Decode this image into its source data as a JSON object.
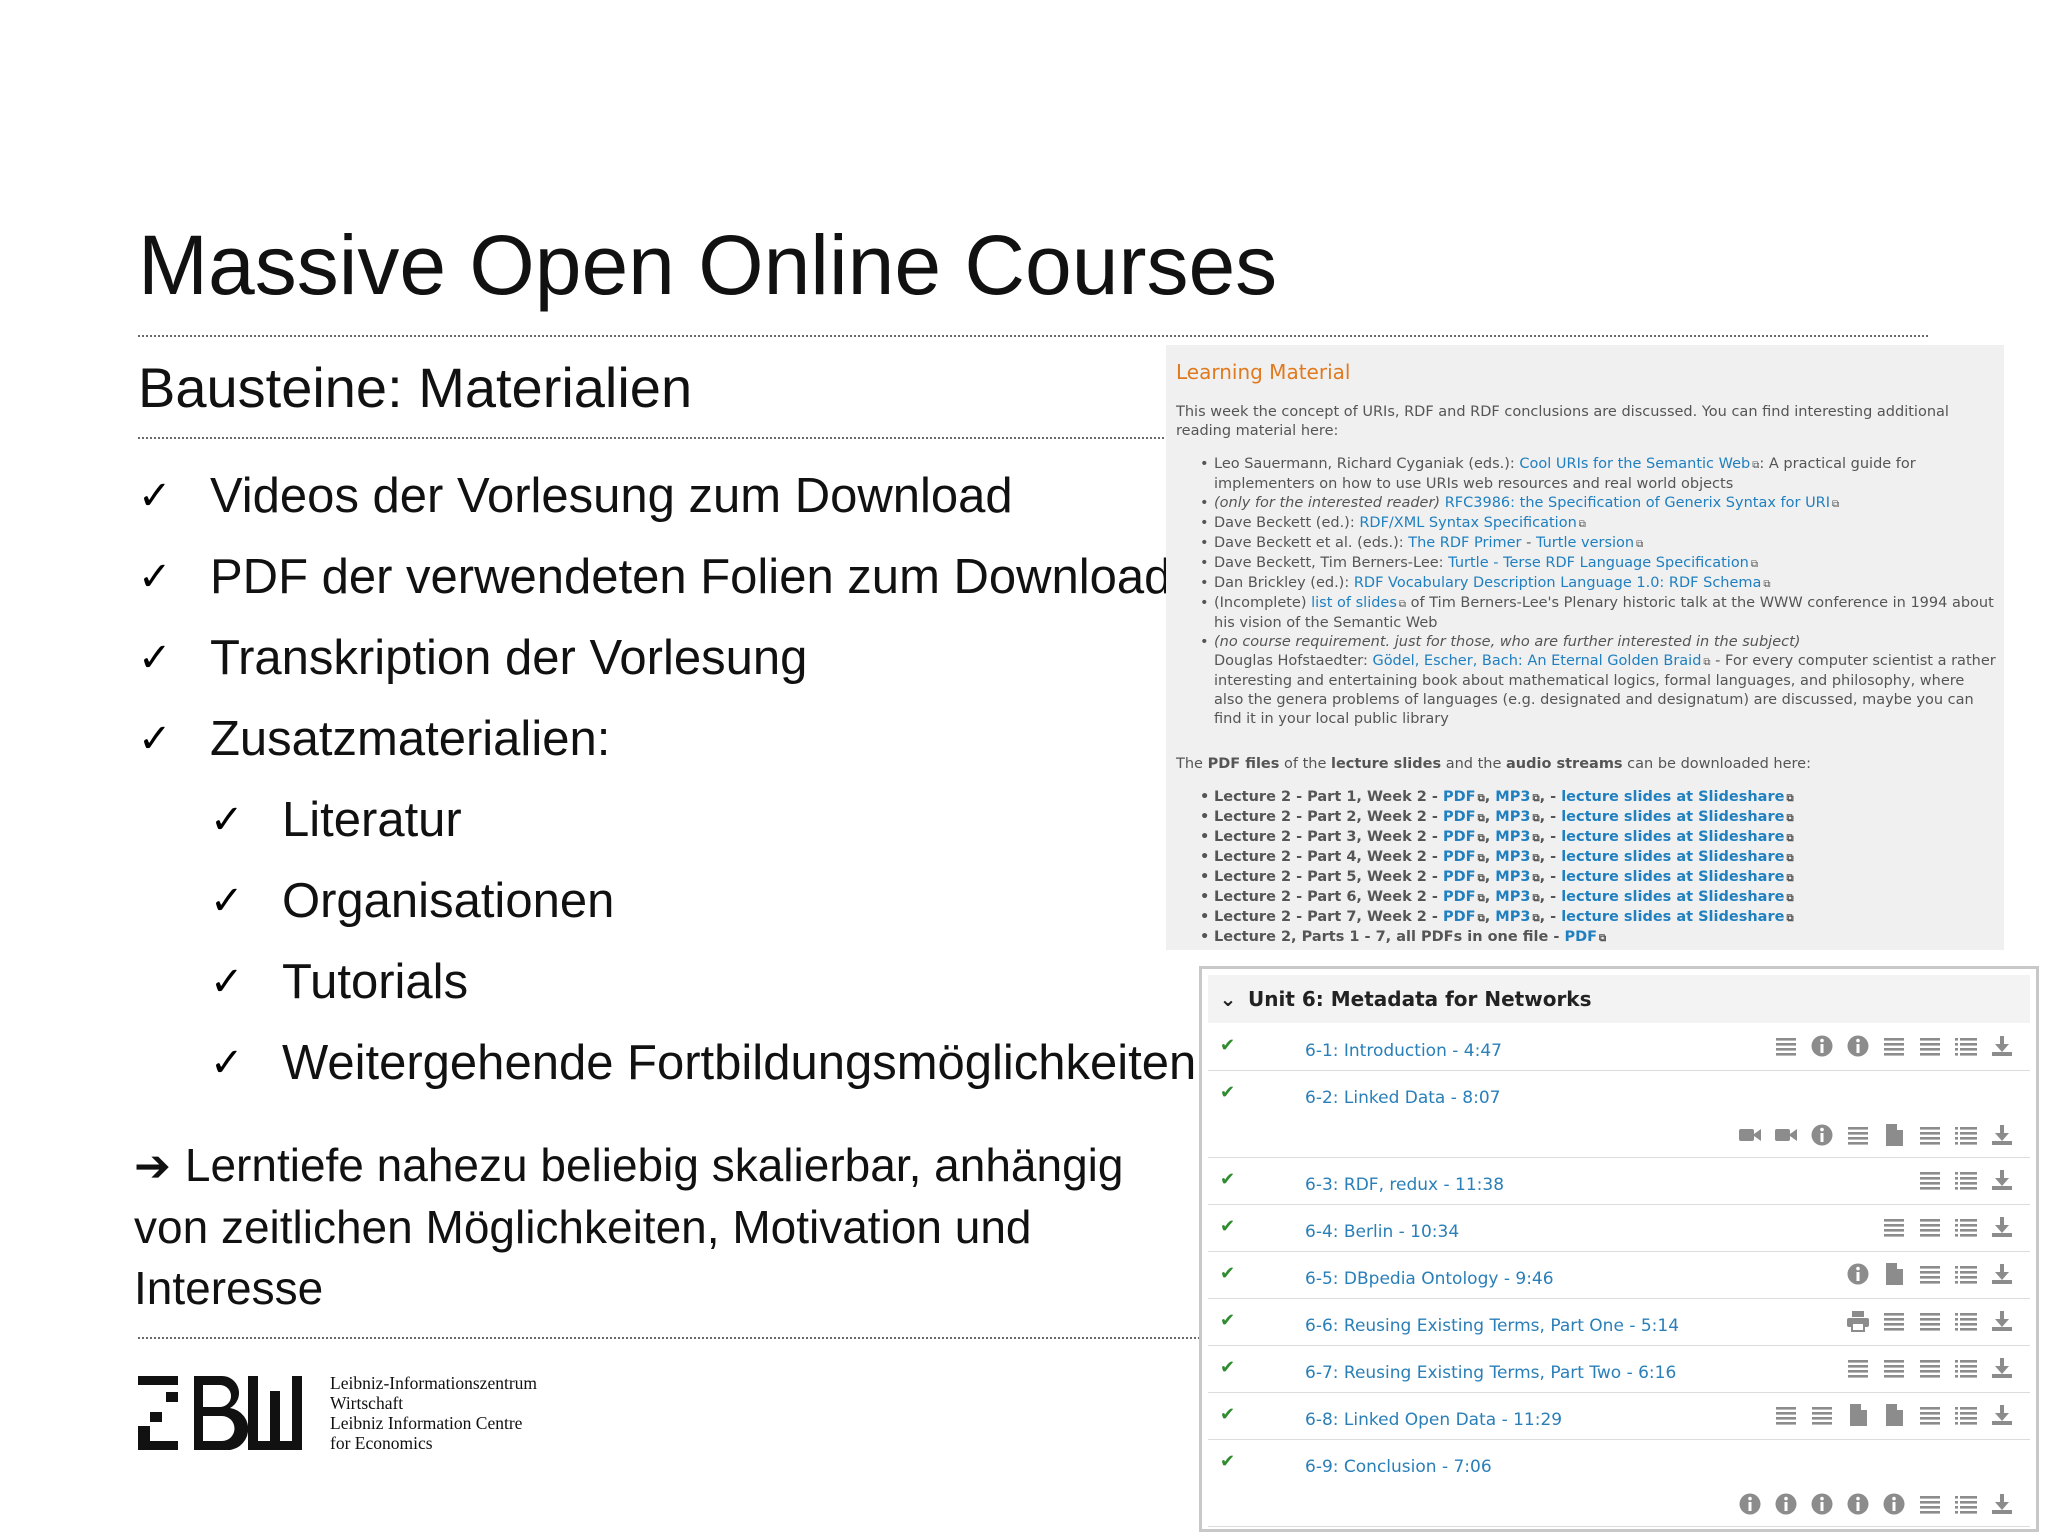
{
  "slide": {
    "title": "Massive Open Online Courses",
    "subtitle": "Bausteine: Materialien",
    "bullets": [
      "Videos der Vorlesung zum Download",
      "PDF der verwendeten Folien zum Download",
      "Transkription der Vorlesung",
      "Zusatzmaterialien:"
    ],
    "sub_bullets": [
      "Literatur",
      "Organisationen",
      "Tutorials",
      "Weitergehende Fortbildungsmöglichkeiten"
    ],
    "check_glyph": "✓",
    "arrow_glyph": "➔",
    "conclusion": "Lerntiefe nahezu beliebig skalierbar, anhängig von zeitlichen Möglichkeiten, Motivation und Interesse"
  },
  "logo": {
    "line1": "Leibniz-Informationszentrum",
    "line2": "Wirtschaft",
    "line3": "Leibniz Information Centre",
    "line4": "for Economics"
  },
  "learning_material": {
    "heading": "Learning Material",
    "intro": "This week the concept of URIs, RDF and RDF conclusions are discussed. You can find interesting additional reading material here:",
    "refs": {
      "r1_pre": "Leo Sauermann, Richard Cyganiak (eds.): ",
      "r1_link": "Cool URIs for the Semantic Web",
      "r1_post": ": A practical guide for implementers on how to use URIs web resources and real world objects",
      "r2_pre": "(only for the interested reader) ",
      "r2_link": "RFC3986: the Specification of Generix Syntax for URI",
      "r3_pre": "Dave Beckett (ed.): ",
      "r3_link": "RDF/XML Syntax Specification",
      "r4_pre": "Dave Beckett et al. (eds.): ",
      "r4_link": "The RDF Primer",
      "r4_sep": " - ",
      "r4_link2": "Turtle version",
      "r5_pre": "Dave Beckett, Tim Berners-Lee: ",
      "r5_link": "Turtle - Terse RDF Language Specification",
      "r6_pre": "Dan Brickley (ed.): ",
      "r6_link": "RDF Vocabulary Description Language 1.0: RDF Schema",
      "r7_pre": "(Incomplete) ",
      "r7_link": "list of slides",
      "r7_post": " of Tim Berners-Lee's Plenary historic talk at the WWW conference in 1994 about his vision of the Semantic Web",
      "r8_pre": "(no course requirement. just for those, who are further interested in the subject)",
      "r8_line2_pre": "Douglas Hofstaedter: ",
      "r8_link": "Gödel, Escher, Bach: An Eternal Golden Braid",
      "r8_post": " - For every computer scientist a rather interesting and entertaining book about mathematical logics, formal languages, and philosophy, where also the genera problems of languages (e.g. designated and designatum) are discussed, maybe you can find it in your local public library"
    },
    "pdf_intro_1": "The ",
    "pdf_intro_b1": "PDF files",
    "pdf_intro_2": " of the ",
    "pdf_intro_b2": "lecture slides",
    "pdf_intro_3": " and the ",
    "pdf_intro_b3": "audio streams",
    "pdf_intro_4": " can be downloaded here:",
    "lectures": [
      "Lecture 2 - Part 1, Week 2 - ",
      "Lecture 2 - Part 2, Week 2 - ",
      "Lecture 2 - Part 3, Week 2 - ",
      "Lecture 2 - Part 4, Week 2 - ",
      "Lecture 2 - Part 5, Week 2 - ",
      "Lecture 2 - Part 6, Week 2 - ",
      "Lecture 2 - Part 7, Week 2 - "
    ],
    "pdf_label": "PDF",
    "mp3_label": "MP3",
    "slideshare_label": "lecture slides at Slideshare",
    "all_pdfs": "Lecture 2, Parts 1 - 7, all PDFs in one file - ",
    "ext_glyph": "⧉"
  },
  "unit": {
    "chevron": "⌄",
    "title": "Unit 6: Metadata for Networks",
    "check": "✔",
    "items": [
      {
        "label": "6-1: Introduction - 4:47",
        "icons": [
          "list",
          "info",
          "info",
          "list",
          "list",
          "listnum",
          "download"
        ]
      },
      {
        "label": "6-2: Linked Data - 8:07",
        "icons": [
          "video",
          "video",
          "info",
          "list",
          "doc",
          "list",
          "listnum",
          "download"
        ]
      },
      {
        "label": "6-3: RDF, redux - 11:38",
        "icons": [
          "list",
          "listnum",
          "download"
        ]
      },
      {
        "label": "6-4: Berlin - 10:34",
        "icons": [
          "list",
          "list",
          "listnum",
          "download"
        ]
      },
      {
        "label": "6-5: DBpedia Ontology - 9:46",
        "icons": [
          "info",
          "doc",
          "list",
          "listnum",
          "download"
        ]
      },
      {
        "label": "6-6: Reusing Existing Terms, Part One - 5:14",
        "icons": [
          "print",
          "list",
          "list",
          "listnum",
          "download"
        ]
      },
      {
        "label": "6-7: Reusing Existing Terms, Part Two - 6:16",
        "icons": [
          "list",
          "list",
          "list",
          "listnum",
          "download"
        ]
      },
      {
        "label": "6-8: Linked Open Data - 11:29",
        "icons": [
          "list",
          "list",
          "doc",
          "doc",
          "list",
          "listnum",
          "download"
        ]
      },
      {
        "label": "6-9: Conclusion - 7:06",
        "icons": [
          "info",
          "info",
          "info",
          "info",
          "info",
          "list",
          "listnum",
          "download"
        ]
      }
    ]
  }
}
